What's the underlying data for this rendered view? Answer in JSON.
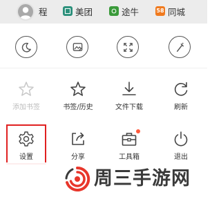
{
  "topbar": {
    "shortcuts": [
      {
        "label": "程",
        "icon": "site-icon",
        "color": "#d33b2c",
        "glyph": ""
      },
      {
        "label": "美团",
        "icon": "meituan-icon",
        "color": "#2a8f7a",
        "glyph": ""
      },
      {
        "label": "途牛",
        "icon": "tuniu-icon",
        "color": "#3a9a3a",
        "glyph": ""
      },
      {
        "label": "同城",
        "icon": "tongcheng-icon",
        "color": "#f07a1e",
        "glyph": "58"
      }
    ]
  },
  "menu": {
    "quick_toggles": [
      {
        "name": "night-mode-button",
        "icon": "moon-icon"
      },
      {
        "name": "no-image-mode-button",
        "icon": "image-off-icon"
      },
      {
        "name": "fullscreen-button",
        "icon": "fullscreen-icon"
      },
      {
        "name": "incognito-button",
        "icon": "clean-wand-icon"
      }
    ],
    "row1": [
      {
        "label": "添加书签",
        "icon": "star-outline-icon",
        "disabled": true
      },
      {
        "label": "书签/历史",
        "icon": "star-icon",
        "disabled": false
      },
      {
        "label": "文件下载",
        "icon": "download-icon",
        "disabled": false
      },
      {
        "label": "刷新",
        "icon": "refresh-icon",
        "disabled": false
      }
    ],
    "row2": [
      {
        "label": "设置",
        "icon": "gear-icon",
        "disabled": false
      },
      {
        "label": "分享",
        "icon": "share-icon",
        "disabled": false
      },
      {
        "label": "工具箱",
        "icon": "toolbox-icon",
        "disabled": false,
        "badge": true
      },
      {
        "label": "退出",
        "icon": "power-icon",
        "disabled": false
      }
    ]
  },
  "watermark": {
    "text": "周三手游网",
    "logo_colors": [
      "#e8362b",
      "#3a3a3a"
    ]
  },
  "colors": {
    "highlight": "#e02020",
    "badge": "#ff5a3c",
    "icon": "#555555"
  }
}
